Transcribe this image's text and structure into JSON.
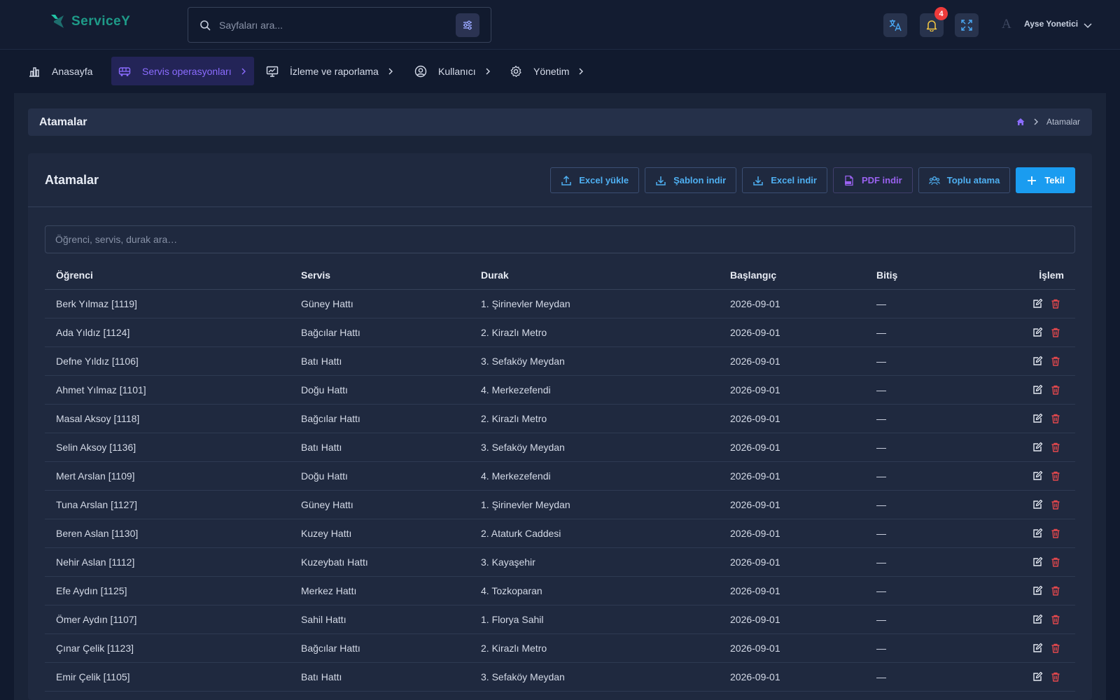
{
  "header": {
    "logo_text_a": "Service",
    "logo_text_b": "Y",
    "search_placeholder": "Sayfaları ara...",
    "notification_count": "4",
    "avatar_letter": "A",
    "user_name": "Ayse Yonetici",
    "colors": {
      "background": "#131c31",
      "accent": "#8b6cff",
      "primary": "#1a9cf0",
      "danger": "#ef3b3b"
    }
  },
  "nav": {
    "items": [
      {
        "label": "Anasayfa",
        "icon": "chart-bar-icon"
      },
      {
        "label": "Servis operasyonları",
        "icon": "bus-icon"
      },
      {
        "label": "İzleme ve raporlama",
        "icon": "monitor-icon"
      },
      {
        "label": "Kullanıcı",
        "icon": "user-circle-icon"
      },
      {
        "label": "Yönetim",
        "icon": "gear-icon"
      }
    ]
  },
  "page": {
    "title": "Atamalar",
    "breadcrumb_current": "Atamalar"
  },
  "card": {
    "title": "Atamalar",
    "actions": {
      "excel_upload": "Excel yükle",
      "template_download": "Şablon indir",
      "excel_download": "Excel indir",
      "pdf_download": "PDF indir",
      "bulk_assign": "Toplu atama",
      "single": "Tekil"
    },
    "search_placeholder": "Öğrenci, servis, durak ara…"
  },
  "table": {
    "columns": [
      "Öğrenci",
      "Servis",
      "Durak",
      "Başlangıç",
      "Bitiş",
      "İşlem"
    ],
    "rows": [
      [
        "Berk Yılmaz [1119]",
        "Güney Hattı",
        "1. Şirinevler Meydan",
        "2026-09-01",
        "—"
      ],
      [
        "Ada Yıldız [1124]",
        "Bağcılar Hattı",
        "2. Kirazlı Metro",
        "2026-09-01",
        "—"
      ],
      [
        "Defne Yıldız [1106]",
        "Batı Hattı",
        "3. Sefaköy Meydan",
        "2026-09-01",
        "—"
      ],
      [
        "Ahmet Yılmaz [1101]",
        "Doğu Hattı",
        "4. Merkezefendi",
        "2026-09-01",
        "—"
      ],
      [
        "Masal Aksoy [1118]",
        "Bağcılar Hattı",
        "2. Kirazlı Metro",
        "2026-09-01",
        "—"
      ],
      [
        "Selin Aksoy [1136]",
        "Batı Hattı",
        "3. Sefaköy Meydan",
        "2026-09-01",
        "—"
      ],
      [
        "Mert Arslan [1109]",
        "Doğu Hattı",
        "4. Merkezefendi",
        "2026-09-01",
        "—"
      ],
      [
        "Tuna Arslan [1127]",
        "Güney Hattı",
        "1. Şirinevler Meydan",
        "2026-09-01",
        "—"
      ],
      [
        "Beren Aslan [1130]",
        "Kuzey Hattı",
        "2. Ataturk Caddesi",
        "2026-09-01",
        "—"
      ],
      [
        "Nehir Aslan [1112]",
        "Kuzeybatı Hattı",
        "3. Kayaşehir",
        "2026-09-01",
        "—"
      ],
      [
        "Efe Aydın [1125]",
        "Merkez Hattı",
        "4. Tozkoparan",
        "2026-09-01",
        "—"
      ],
      [
        "Ömer Aydın [1107]",
        "Sahil Hattı",
        "1. Florya Sahil",
        "2026-09-01",
        "—"
      ],
      [
        "Çınar Çelik [1123]",
        "Bağcılar Hattı",
        "2. Kirazlı Metro",
        "2026-09-01",
        "—"
      ],
      [
        "Emir Çelik [1105]",
        "Batı Hattı",
        "3. Sefaköy Meydan",
        "2026-09-01",
        "—"
      ]
    ]
  }
}
